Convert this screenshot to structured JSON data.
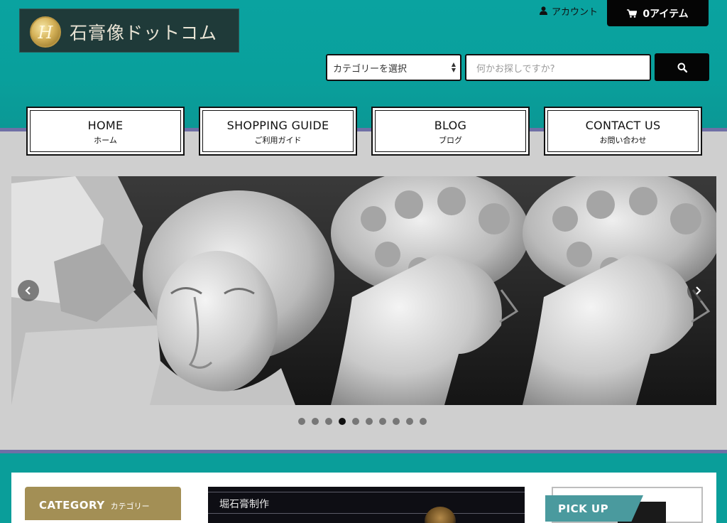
{
  "site": {
    "logo_text": "石膏像ドットコム",
    "emblem_letter": "H"
  },
  "header": {
    "account_label": "アカウント",
    "cart_label": "0アイテム"
  },
  "search": {
    "category_selected": "カテゴリーを選択",
    "placeholder": "何かお探しですか?"
  },
  "nav": {
    "items": [
      {
        "en": "HOME",
        "jp": "ホーム"
      },
      {
        "en": "SHOPPING GUIDE",
        "jp": "ご利用ガイド"
      },
      {
        "en": "BLOG",
        "jp": "ブログ"
      },
      {
        "en": "CONTACT US",
        "jp": "お問い合わせ"
      }
    ]
  },
  "slider": {
    "slide_count": 10,
    "active_index": 3
  },
  "sidebar": {
    "category_en": "CATEGORY",
    "category_jp": "カテゴリー"
  },
  "feature": {
    "title": "堀石膏制作"
  },
  "pickup": {
    "label": "PICK UP"
  },
  "colors": {
    "header_teal": "#0aa3a0",
    "band_grey": "#cfcfcf",
    "band_border": "#6f6fa6",
    "category_gold": "#a38f55",
    "pickup_teal": "#4a9a9e",
    "dark": "#050505"
  },
  "icons": [
    "user-icon",
    "cart-icon",
    "search-icon",
    "chevron-left-icon",
    "chevron-right-icon",
    "select-arrows-icon"
  ]
}
